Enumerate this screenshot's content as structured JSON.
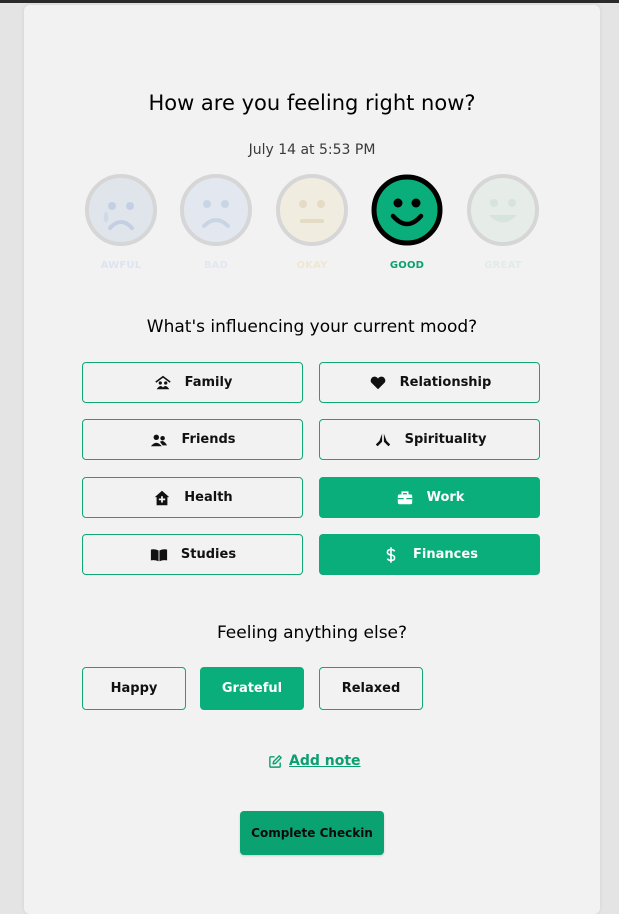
{
  "header": {
    "title": "How are you feeling right now?",
    "datetime": "July 14 at 5:53 PM"
  },
  "moods": [
    {
      "label": "AWFUL",
      "icon": "awful-face-icon",
      "color": "#a9bcd4",
      "selected": false
    },
    {
      "label": "BAD",
      "icon": "bad-face-icon",
      "color": "#b7c7de",
      "selected": false
    },
    {
      "label": "OKAY",
      "icon": "okay-face-icon",
      "color": "#eadfb8",
      "selected": false
    },
    {
      "label": "GOOD",
      "icon": "good-face-icon",
      "color": "#0aae7a",
      "selected": true
    },
    {
      "label": "GREAT",
      "icon": "great-face-icon",
      "color": "#c3d8cc",
      "selected": false
    }
  ],
  "influences": {
    "title": "What's influencing your current mood?",
    "items": [
      {
        "label": "Family",
        "icon": "family-icon",
        "selected": false
      },
      {
        "label": "Relationship",
        "icon": "heart-icon",
        "selected": false
      },
      {
        "label": "Friends",
        "icon": "friends-icon",
        "selected": false
      },
      {
        "label": "Spirituality",
        "icon": "praying-hands-icon",
        "selected": false
      },
      {
        "label": "Health",
        "icon": "house-medical-icon",
        "selected": false
      },
      {
        "label": "Work",
        "icon": "briefcase-icon",
        "selected": true
      },
      {
        "label": "Studies",
        "icon": "book-icon",
        "selected": false
      },
      {
        "label": "Finances",
        "icon": "dollar-icon",
        "selected": true
      }
    ]
  },
  "feelings": {
    "title": "Feeling anything else?",
    "items": [
      {
        "label": "Happy",
        "selected": false
      },
      {
        "label": "Grateful",
        "selected": true
      },
      {
        "label": "Relaxed",
        "selected": false
      }
    ]
  },
  "add_note": {
    "label": "Add note",
    "icon": "edit-icon"
  },
  "complete_button": {
    "label": "Complete Checkin"
  },
  "colors": {
    "accent": "#0aae7a",
    "card_background": "#f2f2f2",
    "page_background": "#e4e4e4"
  }
}
